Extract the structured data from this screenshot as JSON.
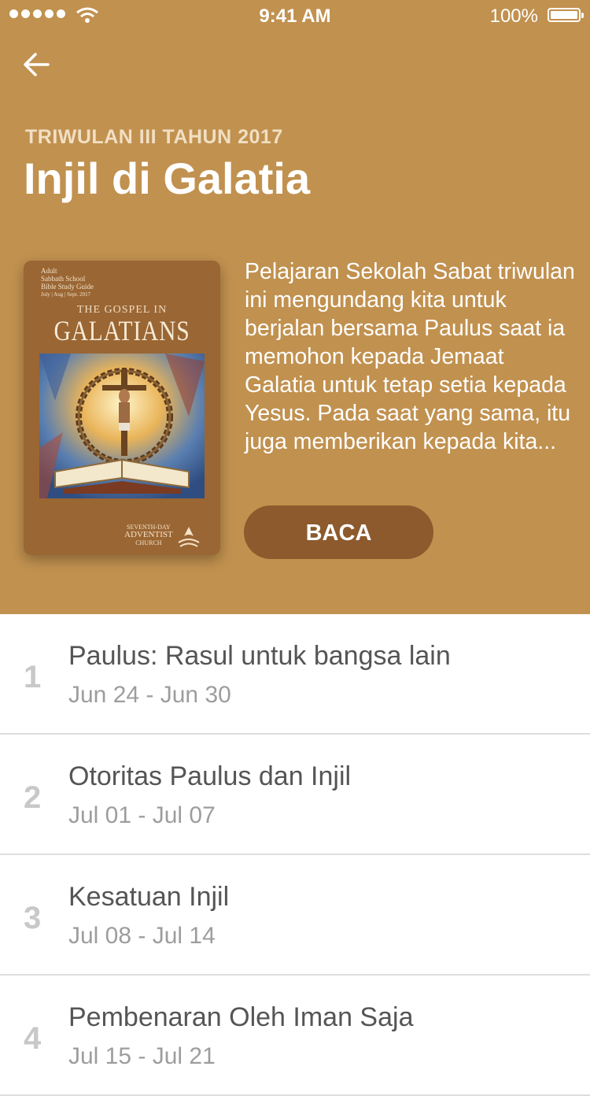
{
  "status_bar": {
    "time": "9:41 AM",
    "battery": "100%"
  },
  "header": {
    "quarter_label": "TRIWULAN III TAHUN 2017",
    "title": "Injil di Galatia",
    "description": "Pelajaran Sekolah Sabat triwulan ini mengundang kita untuk berjalan bersama Paulus saat ia memohon kepada Jemaat Galatia untuk tetap setia kepada Yesus. Pada saat yang sama, itu juga memberikan kepada kita...",
    "read_button": "BACA",
    "background_color": "#c1914f"
  },
  "cover": {
    "line1": "Adult",
    "line2": "Sabbath School",
    "line3": "Bible Study Guide",
    "line4": "July | Aug | Sept. 2017",
    "gospel": "THE GOSPEL IN",
    "galatians": "GALATIANS",
    "church1": "SEVENTH-DAY",
    "church2": "ADVENTIST",
    "church3": "CHURCH"
  },
  "lessons": [
    {
      "number": "1",
      "title": "Paulus: Rasul untuk bangsa lain",
      "dates": "Jun 24 - Jun 30"
    },
    {
      "number": "2",
      "title": "Otoritas Paulus dan Injil",
      "dates": "Jul 01 - Jul 07"
    },
    {
      "number": "3",
      "title": "Kesatuan Injil",
      "dates": "Jul 08 - Jul 14"
    },
    {
      "number": "4",
      "title": "Pembenaran Oleh Iman Saja",
      "dates": "Jul 15 - Jul 21"
    }
  ]
}
